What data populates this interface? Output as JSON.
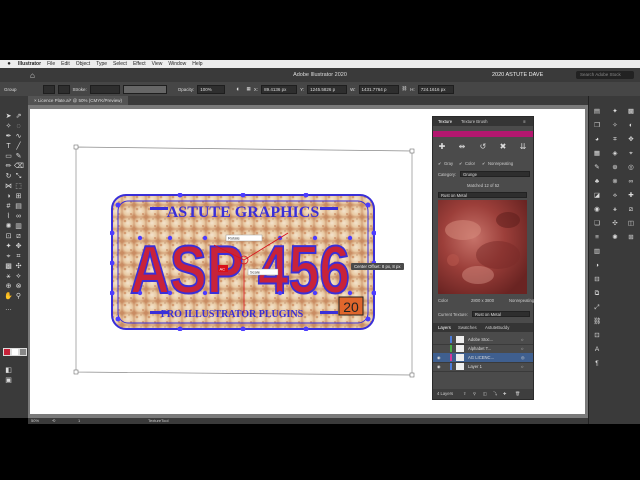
{
  "menu": {
    "app": "Illustrator",
    "items": [
      "File",
      "Edit",
      "Object",
      "Type",
      "Select",
      "Effect",
      "View",
      "Window",
      "Help"
    ]
  },
  "appbar": {
    "title": "Adobe Illustrator 2020",
    "workspace": "2020 ASTUTE DAVE",
    "search_placeholder": "Search Adobe Stock"
  },
  "control": {
    "selection": "Group",
    "stroke_label": "Stroke:",
    "opacity_label": "Opacity:",
    "opacity_value": "100%",
    "x_label": "X:",
    "x_value": "89.4136 px",
    "y_label": "Y:",
    "y_value": "1245.5826 p",
    "w_label": "W:",
    "w_value": "1431.7764 p",
    "h_label": "H:",
    "h_value": "724.1616 px"
  },
  "document": {
    "tab": "Licence Plate.ai* @ 50% (CMYK/Preview)",
    "zoom": "50%",
    "page": "1",
    "tool": "TextureTool"
  },
  "plate": {
    "top_text": "ASTUTE GRAPHICS",
    "main_text": "ASP 456",
    "bottom_text": "PRO ILLUSTRATOR PLUGINS",
    "year": "20",
    "tooltip": "Center Offset: 8 px, 8 px",
    "mini_label": "Rotate",
    "mini_label2": "Scale",
    "mini_badge": "AC"
  },
  "texture_panel": {
    "tab_texture": "Texture",
    "tab_brush": "Texture Brush",
    "gray_label": "Gray",
    "color_label": "Color",
    "nonrepeating_label": "Nonrepeating",
    "category_label": "Category:",
    "category_value": "Grunge",
    "matched": "Matched 12 of 52",
    "texture_name": "Rust on Metal",
    "color_label2": "Color",
    "size": "2800 x 3800",
    "mode": "Nonrepeating",
    "current_label": "Current Texture:",
    "current_value": "Rust on Metal"
  },
  "layers_panel": {
    "tabs": [
      "Layers",
      "Swatches",
      "AstuteBuddy"
    ],
    "rows": [
      {
        "name": "Adobe Stoc...",
        "color": "#4b7bd8"
      },
      {
        "name": "Alphabet T...",
        "color": "#46b046"
      },
      {
        "name": "AG LICENC...",
        "color": "#d6379a"
      },
      {
        "name": "Layer 1",
        "color": "#4b7bd8"
      }
    ],
    "footer": "4 Layers"
  },
  "colors": {
    "accent_pink": "#b3176f",
    "plate_blue": "#3a2fd8",
    "plate_red": "#c8233a",
    "year_orange": "#e0662c"
  }
}
